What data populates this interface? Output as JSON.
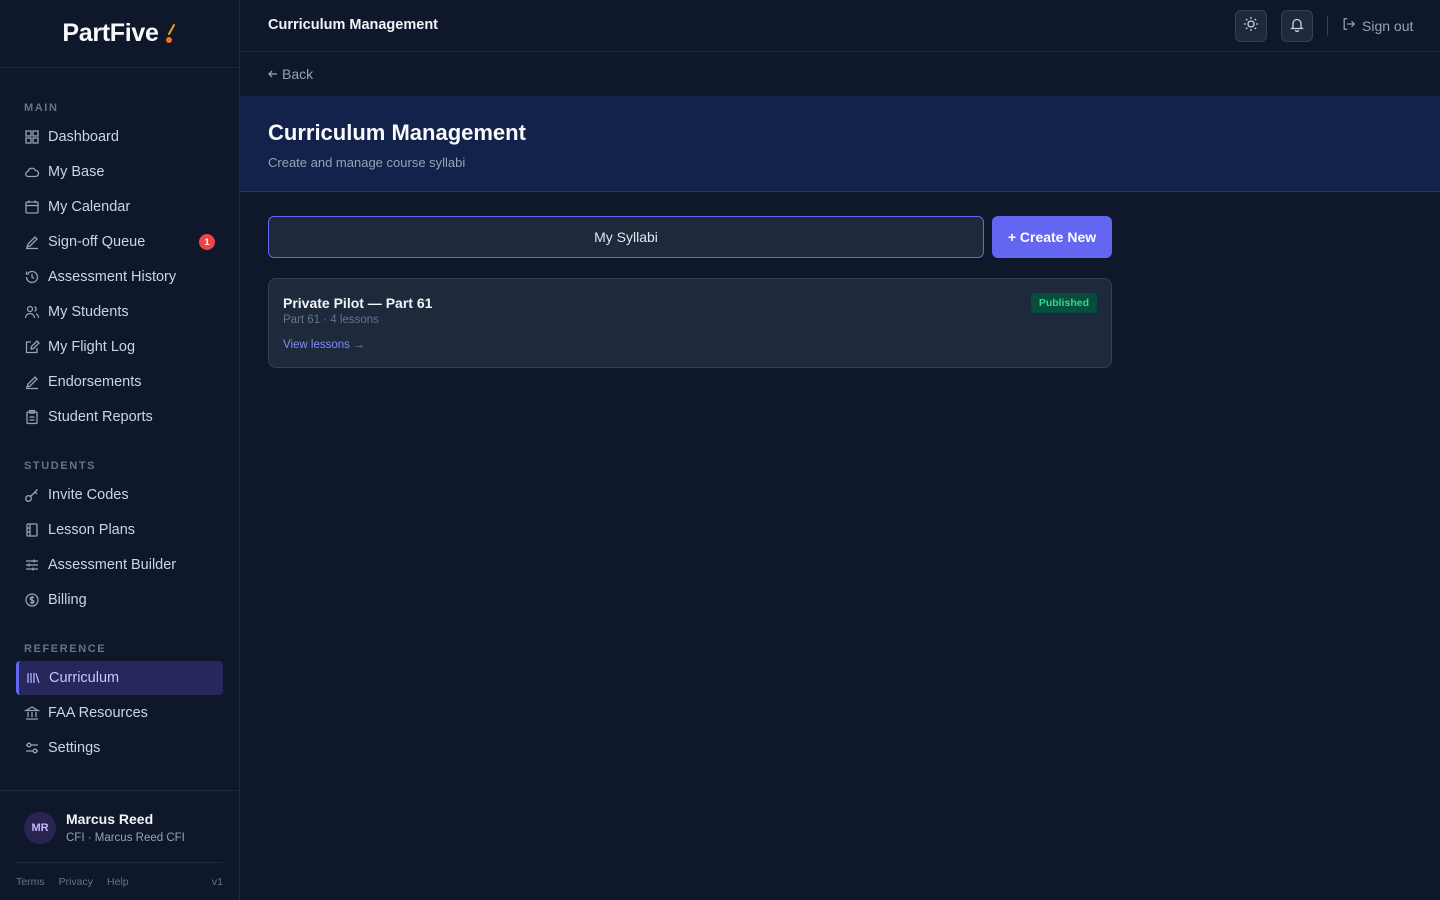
{
  "app": {
    "name": "PartFive"
  },
  "sidebar": {
    "sections": [
      {
        "label": "MAIN",
        "items": [
          {
            "label": "Dashboard",
            "icon": "grid-icon"
          },
          {
            "label": "My Base",
            "icon": "cloud-icon"
          },
          {
            "label": "My Calendar",
            "icon": "calendar-icon"
          },
          {
            "label": "Sign-off Queue",
            "icon": "pen-icon",
            "badge": "1"
          },
          {
            "label": "Assessment History",
            "icon": "history-icon"
          },
          {
            "label": "My Students",
            "icon": "users-icon"
          },
          {
            "label": "My Flight Log",
            "icon": "edit-log-icon"
          },
          {
            "label": "Endorsements",
            "icon": "pen-icon"
          },
          {
            "label": "Student Reports",
            "icon": "clipboard-icon"
          }
        ]
      },
      {
        "label": "STUDENTS",
        "items": [
          {
            "label": "Invite Codes",
            "icon": "key-icon"
          },
          {
            "label": "Lesson Plans",
            "icon": "book-icon"
          },
          {
            "label": "Assessment Builder",
            "icon": "sliders-icon"
          },
          {
            "label": "Billing",
            "icon": "dollar-icon"
          }
        ]
      },
      {
        "label": "REFERENCE",
        "items": [
          {
            "label": "Curriculum",
            "icon": "library-icon",
            "active": true
          },
          {
            "label": "FAA Resources",
            "icon": "landmark-icon"
          },
          {
            "label": "Settings",
            "icon": "settings-icon"
          }
        ]
      }
    ],
    "user": {
      "initials": "MR",
      "name": "Marcus Reed",
      "role": "CFI · Marcus Reed CFI"
    },
    "footer": {
      "links": [
        "Terms",
        "Privacy",
        "Help"
      ],
      "version": "v1"
    }
  },
  "topbar": {
    "title": "Curriculum Management",
    "sign_out": "Sign out"
  },
  "back": {
    "label": "Back"
  },
  "header": {
    "title": "Curriculum Management",
    "subtitle": "Create and manage course syllabi"
  },
  "tabs": {
    "my_syllabi": "My Syllabi",
    "create_new": "+ Create New"
  },
  "syllabi": [
    {
      "title": "Private Pilot — Part 61",
      "meta": "Part 61 · 4 lessons",
      "link": "View lessons →",
      "status": "Published"
    }
  ],
  "colors": {
    "accent": "#6366f1",
    "background": "#0f172a",
    "published": "#34d399",
    "badge": "#ef4444"
  }
}
